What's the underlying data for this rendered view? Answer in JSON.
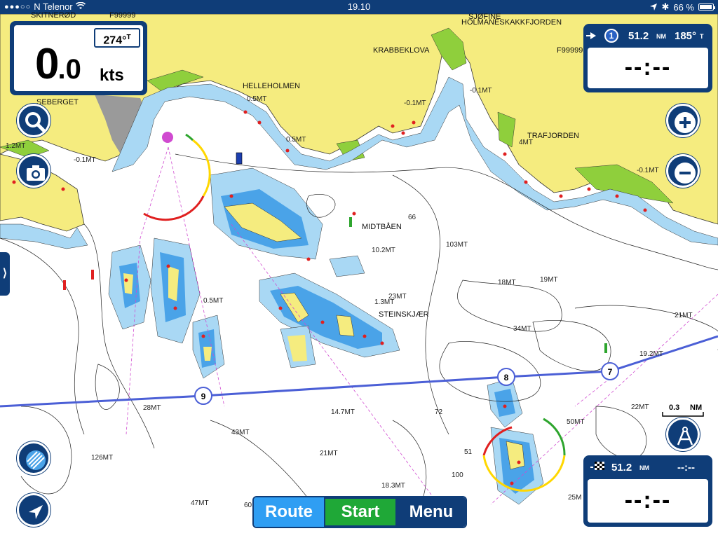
{
  "status_bar": {
    "signal_dots": "●●●○○",
    "carrier": "N Telenor",
    "time": "19.10",
    "battery_pct": "66 %",
    "bluetooth": "✱"
  },
  "speed_panel": {
    "speed_int": "0",
    "speed_dec": ".0",
    "unit": "kts",
    "heading": "274°",
    "heading_ref": "T"
  },
  "waypoint_panel": {
    "waypoint_no": "1",
    "distance": "51.2",
    "distance_unit": "NM",
    "bearing": "185°",
    "bearing_ref": "T",
    "time_display": "--:--"
  },
  "finish_panel": {
    "distance": "51.2",
    "distance_unit": "NM",
    "eta": "--:--",
    "time_display": "--:--"
  },
  "bottom_bar": {
    "route_label": "Route",
    "start_label": "Start",
    "menu_label": "Menu"
  },
  "side_tab": {
    "label": "⟩"
  },
  "scale": {
    "value": "0.3",
    "unit": "NM"
  },
  "place_names": [
    "SKITNERØD",
    "F99999",
    "HELLEHOLMEN",
    "SEBERGET",
    "KRABBEKLOVA",
    "TRAFJORDEN",
    "MIDTBÅEN",
    "STEINSKJÆR",
    "HOLMANESKAKKFJORDEN",
    "SJØFINE"
  ],
  "depth_labels": [
    "-0.1MT",
    "0.5MT",
    "0.5MT",
    "1.2MT",
    "-0.1MT",
    "-0.1MT",
    "-0.1MT",
    "4MT",
    "10.2MT",
    "103MT",
    "18MT",
    "19MT",
    "23MT",
    "1.3MT",
    "0.5MT",
    "34MT",
    "21MT",
    "19.2MT",
    "28MT",
    "14.7MT",
    "43MT",
    "126MT",
    "21MT",
    "18.3MT",
    "47MT",
    "60MT",
    "22MT",
    "50MT",
    "25M",
    "66",
    "72",
    "100",
    "51"
  ],
  "route_waypoints": [
    "9",
    "8",
    "7"
  ]
}
